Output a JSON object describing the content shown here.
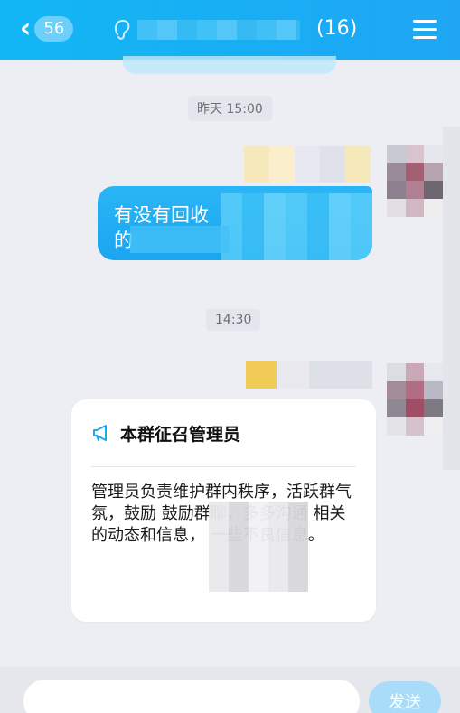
{
  "header": {
    "unread_count": "56",
    "member_count": "(16)",
    "colors": {
      "header_bg": "#12b7f5",
      "badge_bg": "#6cd0fb"
    }
  },
  "timestamps": [
    "昨天 15:00",
    "14:30"
  ],
  "messages": [
    {
      "text": "有没有回收",
      "continuation": "的"
    }
  ],
  "notice": {
    "title": "本群征召管理员",
    "body": "管理员负责维护群内秩序，活跃群气氛，鼓励 鼓励群聊，多多沟通 相关的动态和信息， 一些不良信息。"
  },
  "composer": {
    "placeholder": "",
    "send_label": "发送"
  },
  "icons": [
    "back-chevron-icon",
    "ear-icon",
    "menu-icon",
    "megaphone-icon"
  ]
}
